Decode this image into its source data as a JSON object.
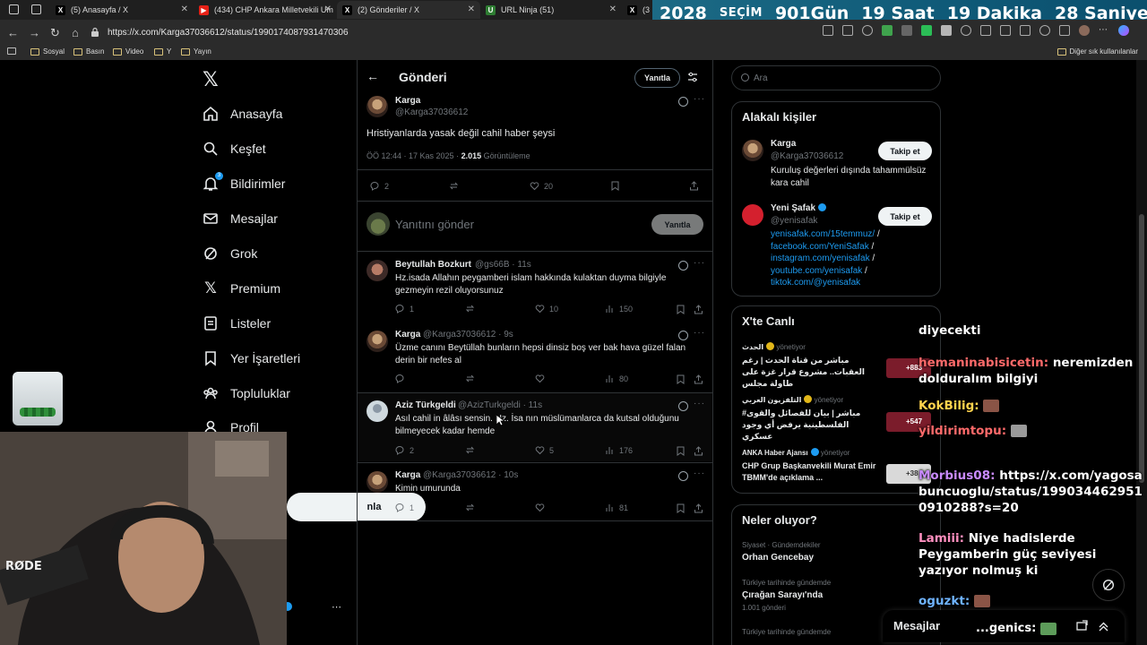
{
  "browser": {
    "tabs": [
      {
        "label": "(5) Anasayfa / X",
        "icon": "x-logo-icon"
      },
      {
        "label": "(434) CHP Ankara Milletvekili Um",
        "icon": "youtube-icon"
      },
      {
        "label": "(2) Gönderiler / X",
        "icon": "x-logo-icon"
      },
      {
        "label": "URL Ninja (51)",
        "icon": "url-ninja-icon"
      },
      {
        "label": "(3",
        "icon": "x-logo-icon"
      }
    ],
    "url": "https://x.com/Karga37036612/status/1990174087931470306",
    "bookmarks": [
      "Sosyal",
      "Basın",
      "Video",
      "Y",
      "Yayın"
    ],
    "bookmarks_other": "Diğer sık kullanılanlar"
  },
  "countdown": {
    "year": "2028",
    "label": "SEÇİM",
    "days": "901Gün",
    "hours": "19 Saat",
    "minutes": "19 Dakika",
    "seconds": "28 Saniye"
  },
  "sidebar": {
    "items": [
      {
        "label": "Anasayfa",
        "icon": "home-icon"
      },
      {
        "label": "Keşfet",
        "icon": "search-icon"
      },
      {
        "label": "Bildirimler",
        "icon": "bell-icon"
      },
      {
        "label": "Mesajlar",
        "icon": "mail-icon"
      },
      {
        "label": "Grok",
        "icon": "grok-icon"
      },
      {
        "label": "Premium",
        "icon": "x-logo-icon"
      },
      {
        "label": "Listeler",
        "icon": "list-icon"
      },
      {
        "label": "Yer İşaretleri",
        "icon": "bookmark-icon"
      },
      {
        "label": "Topluluklar",
        "icon": "communities-icon"
      },
      {
        "label": "Profil",
        "icon": "profile-icon"
      }
    ],
    "notification_count": "3",
    "post_button_visible": "nla"
  },
  "main": {
    "title": "Gönderi",
    "reply_pill": "Yanıtla",
    "main_post": {
      "name": "Karga",
      "handle": "@Karga37036612",
      "text": "Hristiyanlarda yasak değil cahil haber şeysi",
      "time": "ÖÖ 12:44 · 17 Kas 2025 ·",
      "views": "2.015",
      "views_label": "Görüntüleme",
      "replies": "2",
      "likes": "20"
    },
    "reply_box": {
      "placeholder": "Yanıtını gönder",
      "button": "Yanıtla"
    },
    "replies": [
      {
        "name": "Beytullah Bozkurt",
        "handle": "@gs66B · 11s",
        "text": "Hz.isada Allahın peygamberi islam hakkında kulaktan duyma bilgiyle gezmeyin rezil oluyorsunuz",
        "replies": "1",
        "reposts": "",
        "likes": "10",
        "views": "150"
      },
      {
        "name": "Karga",
        "handle": "@Karga37036612 · 9s",
        "text": "Üzme canını Beytüllah bunların hepsi dinsiz boş ver bak hava güzel falan derin bir nefes al",
        "replies": "",
        "reposts": "",
        "likes": "",
        "views": "80"
      },
      {
        "name": "Aziz Türkgeldi",
        "handle": "@AzizTurkgeldi · 11s",
        "text": "Asıl cahil in âlâsı sensin. Hz. İsa nın müslümanlarca da kutsal olduğunu bilmeyecek kadar hemde",
        "replies": "2",
        "reposts": "",
        "likes": "5",
        "views": "176"
      },
      {
        "name": "Karga",
        "handle": "@Karga37036612 · 10s",
        "text": "Kimin umurunda",
        "replies": "1",
        "reposts": "",
        "likes": "",
        "views": "81"
      }
    ]
  },
  "right": {
    "search_placeholder": "Ara",
    "related": {
      "title": "Alakalı kişiler",
      "people": [
        {
          "name": "Karga",
          "handle": "@Karga37036612",
          "bio": "Kuruluş değerleri dışında tahammülsüz kara cahil",
          "button": "Takip et"
        },
        {
          "name": "Yeni Şafak",
          "handle": "@yenisafak",
          "links": [
            "yenisafak.com/15temmuz/",
            "facebook.com/YeniSafak",
            "instagram.com/yenisafak",
            "youtube.com/yenisafak",
            "tiktok.com/@yenisafak"
          ],
          "button": "Takip et"
        }
      ]
    },
    "live": {
      "title": "X'te Canlı",
      "items": [
        {
          "source": "الحدث",
          "status": "yönetiyor",
          "text": "مباشر من قناة الحدث | رغم العقبات.. مشروع قرار غزة على طاولة مجلس",
          "count": "+883"
        },
        {
          "source": "التلفزيون العربي",
          "status": "yönetiyor",
          "text": "مباشر | بيان للفصائل والقوى# الفلسطينية يرفض أي وجود عسكري",
          "count": "+547"
        },
        {
          "source": "ANKA Haber Ajansı",
          "status": "yönetiyor",
          "text": "CHP Grup Başkanvekili Murat Emir TBMM'de açıklama ...",
          "count": "+38"
        }
      ]
    },
    "trends": {
      "title": "Neler oluyor?",
      "items": [
        {
          "category": "Siyaset · Gündemdekiler",
          "name": "Orhan Gencebay",
          "count": ""
        },
        {
          "category": "Türkiye tarihinde gündemde",
          "name": "Çırağan Sarayı'nda",
          "count": "1.001 gönderi"
        },
        {
          "category": "Türkiye tarihinde gündemde",
          "name": "",
          "count": ""
        }
      ]
    },
    "messages_label": "Mesajlar"
  },
  "chat": [
    {
      "user": "",
      "text": "diyecekti"
    },
    {
      "user": "hemaninabisicetin:",
      "text": "neremizden dolduralım bilgiyi"
    },
    {
      "user": "KokBilig:",
      "text": ""
    },
    {
      "user": "yildirimtopu:",
      "text": ""
    },
    {
      "user": "Morbius08:",
      "text": "https://x.com/yagosabuncuoglu/status/1990344629510910288?s=20"
    },
    {
      "user": "Lamiii:",
      "text": "Niye hadislerde Peygamberin güç seviyesi yazıyor nolmuş ki"
    },
    {
      "user": "oguzkt:",
      "text": ""
    },
    {
      "user": "...genics:",
      "text": ""
    }
  ],
  "colors": {
    "accent": "#1d9bf0",
    "background": "#000000",
    "muted": "#71767b",
    "border": "#2f3336"
  }
}
